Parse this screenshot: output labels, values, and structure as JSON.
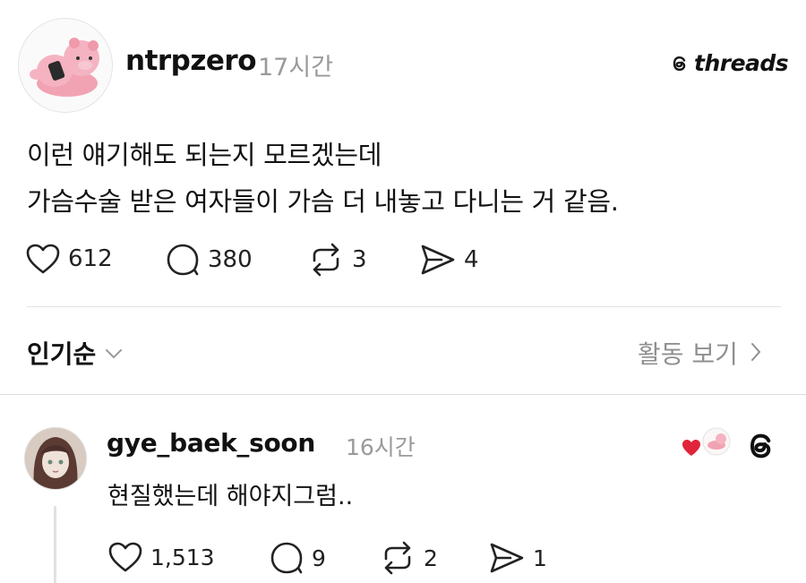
{
  "post": {
    "username": "ntrpzero",
    "time": "17시간",
    "lines": [
      "이런 얘기해도 되는지 모르겠는데",
      "가슴수술 받은 여자들이 가슴 더 내놓고 다니는 거 같음."
    ],
    "likes": "612",
    "comments": "380",
    "reposts": "3",
    "shares": "4",
    "avatar_icon": "pink-bear-avatar"
  },
  "brand": {
    "name": "threads",
    "icon": "threads-logo-icon"
  },
  "sort": {
    "label": "인기순",
    "activity_label": "활동 보기"
  },
  "reply": {
    "username": "gye_baek_soon",
    "time": "16시간",
    "text": "현질했는데 해야지그럼..",
    "likes": "1,513",
    "comments": "9",
    "reposts": "2",
    "shares": "1",
    "avatar_icon": "anime-girl-avatar"
  },
  "colors": {
    "text": "#111111",
    "muted": "#9a9a9a",
    "divider": "#e3e3e3",
    "heart_red": "#e0243a"
  }
}
